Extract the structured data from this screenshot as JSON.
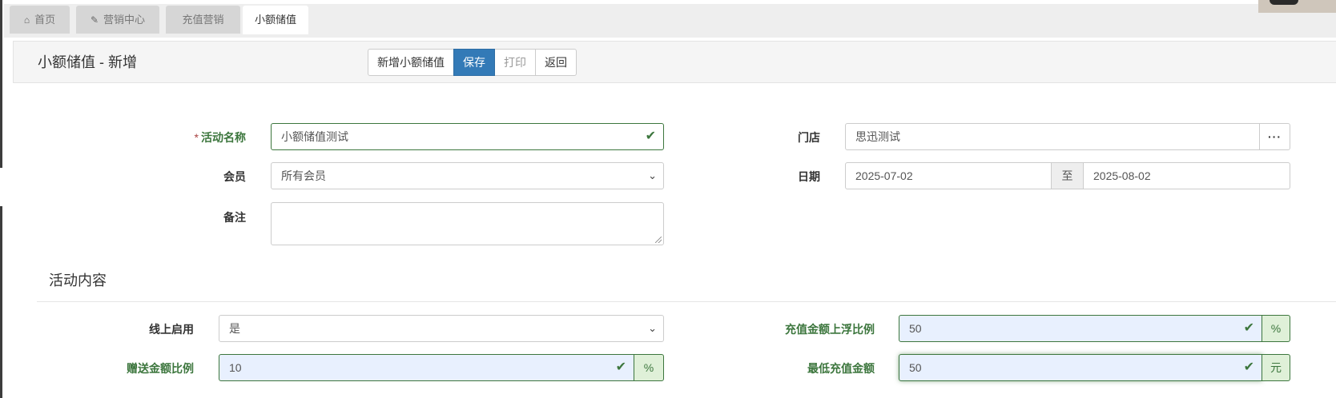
{
  "tabs": [
    {
      "label": "首页",
      "icon": "home-icon"
    },
    {
      "label": "营销中心",
      "icon": "edit-icon"
    },
    {
      "label": "充值营销"
    },
    {
      "label": "小额储值",
      "active": true
    }
  ],
  "header": {
    "title": "小额储值 - 新增",
    "buttons": {
      "new": "新增小额储值",
      "save": "保存",
      "print": "打印",
      "back": "返回"
    }
  },
  "form": {
    "activity_name": {
      "label": "活动名称",
      "required_mark": "*",
      "value": "小额储值测试"
    },
    "store": {
      "label": "门店",
      "value": "思迅测试",
      "button": "···"
    },
    "member": {
      "label": "会员",
      "value": "所有会员"
    },
    "date": {
      "label": "日期",
      "start": "2025-07-02",
      "separator": "至",
      "end": "2025-08-02"
    },
    "remark": {
      "label": "备注",
      "value": ""
    }
  },
  "activity_content": {
    "title": "活动内容",
    "online_enabled": {
      "label": "线上启用",
      "value": "是"
    },
    "bonus_ratio": {
      "label": "赠送金额比例",
      "value": "10",
      "unit": "%"
    },
    "recharge_float_ratio": {
      "label": "充值金额上浮比例",
      "value": "50",
      "unit": "%"
    },
    "min_recharge": {
      "label": "最低充值金额",
      "value": "50",
      "unit": "元"
    }
  },
  "colors": {
    "primary": "#337ab7",
    "success": "#3c763d",
    "autofill": "#e8f0fe"
  }
}
